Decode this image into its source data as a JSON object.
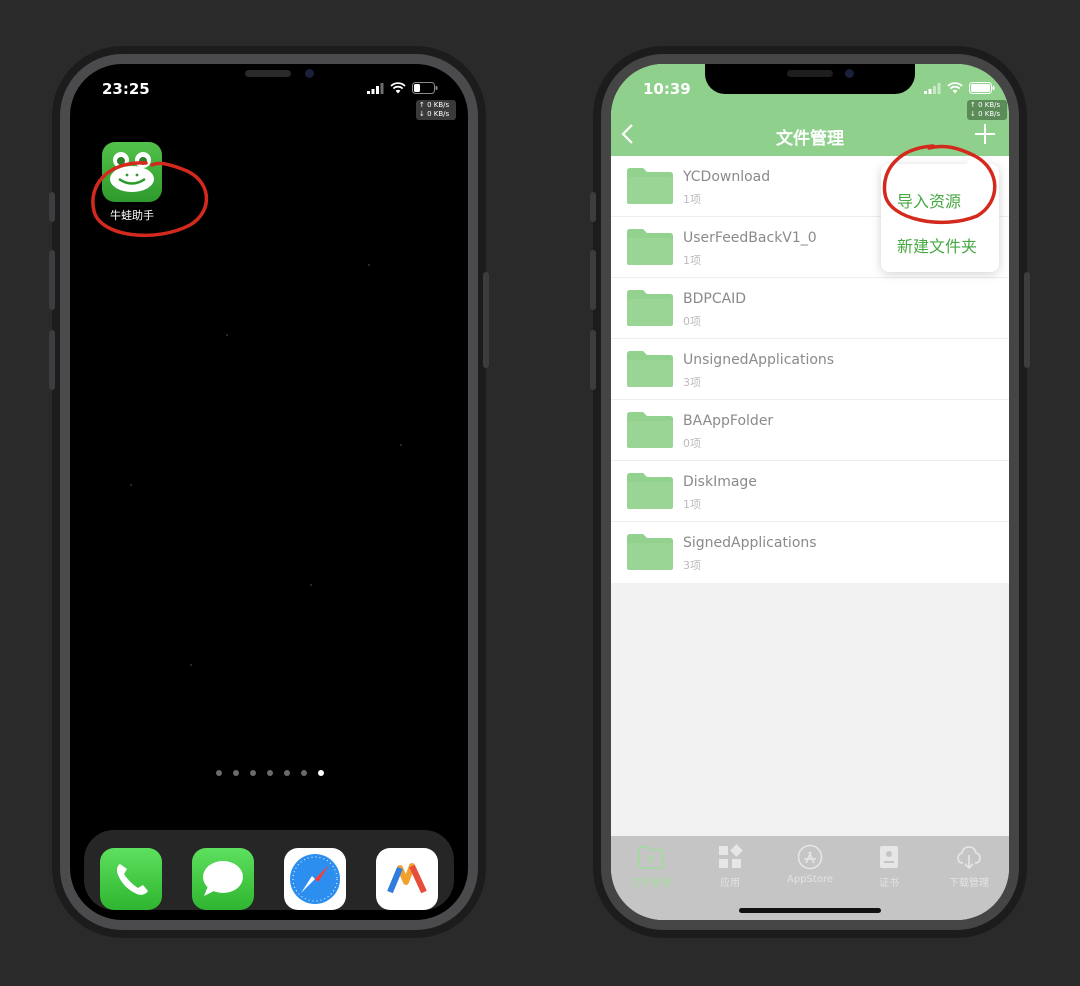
{
  "left_phone": {
    "status": {
      "time": "23:25",
      "speed_up": "↑ 0 KB/s",
      "speed_down": "↓ 0 KB/s"
    },
    "app": {
      "label": "牛蛙助手",
      "icon": "frog-icon"
    },
    "page_dots": {
      "count": 7,
      "active_index": 6
    },
    "dock": [
      "phone-icon",
      "messages-icon",
      "safari-icon",
      "app-icon"
    ]
  },
  "right_phone": {
    "status": {
      "time": "10:39",
      "speed_up": "↑ 0 KB/s",
      "speed_down": "↓ 0 KB/s"
    },
    "nav": {
      "title": "文件管理",
      "back_icon": "chevron-left-icon",
      "add_icon": "plus-icon"
    },
    "files": [
      {
        "name": "YCDownload",
        "count": "1项"
      },
      {
        "name": "UserFeedBackV1_0",
        "count": "1项"
      },
      {
        "name": "BDPCAID",
        "count": "0项"
      },
      {
        "name": "UnsignedApplications",
        "count": "3项"
      },
      {
        "name": "BAAppFolder",
        "count": "0项"
      },
      {
        "name": "DiskImage",
        "count": "1项"
      },
      {
        "name": "SignedApplications",
        "count": "3项"
      }
    ],
    "popup_menu": {
      "import_label": "导入资源",
      "new_folder_label": "新建文件夹"
    },
    "tabs": [
      {
        "label": "文件管理",
        "icon": "folder-icon",
        "active": true
      },
      {
        "label": "应用",
        "icon": "apps-grid-icon",
        "active": false
      },
      {
        "label": "AppStore",
        "icon": "appstore-icon",
        "active": false
      },
      {
        "label": "证书",
        "icon": "certificate-icon",
        "active": false
      },
      {
        "label": "下载管理",
        "icon": "cloud-download-icon",
        "active": false
      }
    ]
  },
  "colors": {
    "background": "#2b2a2a",
    "header_green": "#8fd18c",
    "folder_green": "#92d18e",
    "menu_green": "#48a843",
    "annotation_red": "#d42a1e"
  }
}
